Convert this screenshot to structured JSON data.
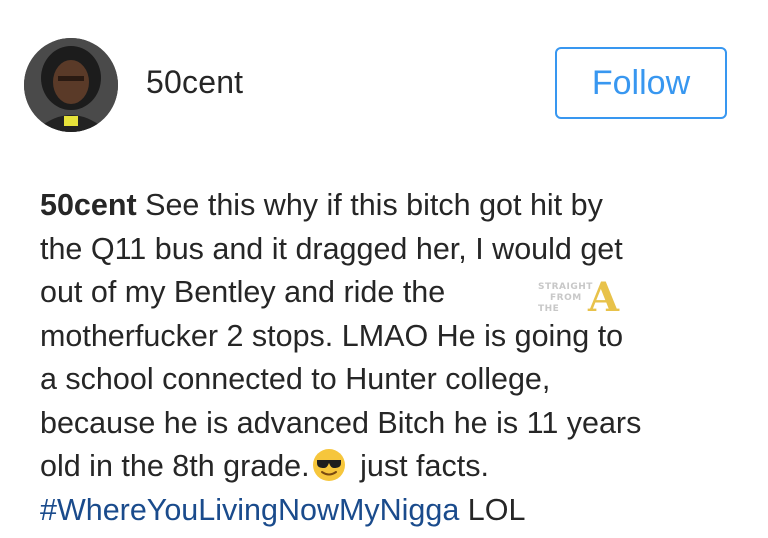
{
  "post": {
    "username": "50cent",
    "follow_label": "Follow"
  },
  "caption": {
    "username": "50cent",
    "lines": [
      " See this why if this bitch got hit by",
      "the Q11 bus and it dragged her, I would get",
      "out of my Bentley and ride the",
      "motherfucker 2 stops. LMAO He is going to",
      "a school connected to Hunter college,",
      "because he is advanced Bitch he is 11 years",
      "old in the 8th grade.",
      " just facts."
    ],
    "hashtag": "#WhereYouLivingNowMyNigga",
    "tail": " LOL"
  },
  "watermark": {
    "line1": "STRAIGHT",
    "line2": "FROM",
    "line3": "THE",
    "letter": "A"
  },
  "icons": {
    "avatar": "profile-photo",
    "emoji": "smiling-face-with-sunglasses"
  },
  "colors": {
    "follow_blue": "#3897f0",
    "hashtag_blue": "#1a4b8c",
    "text": "#262626",
    "watermark_gold": "#e8c24a"
  }
}
